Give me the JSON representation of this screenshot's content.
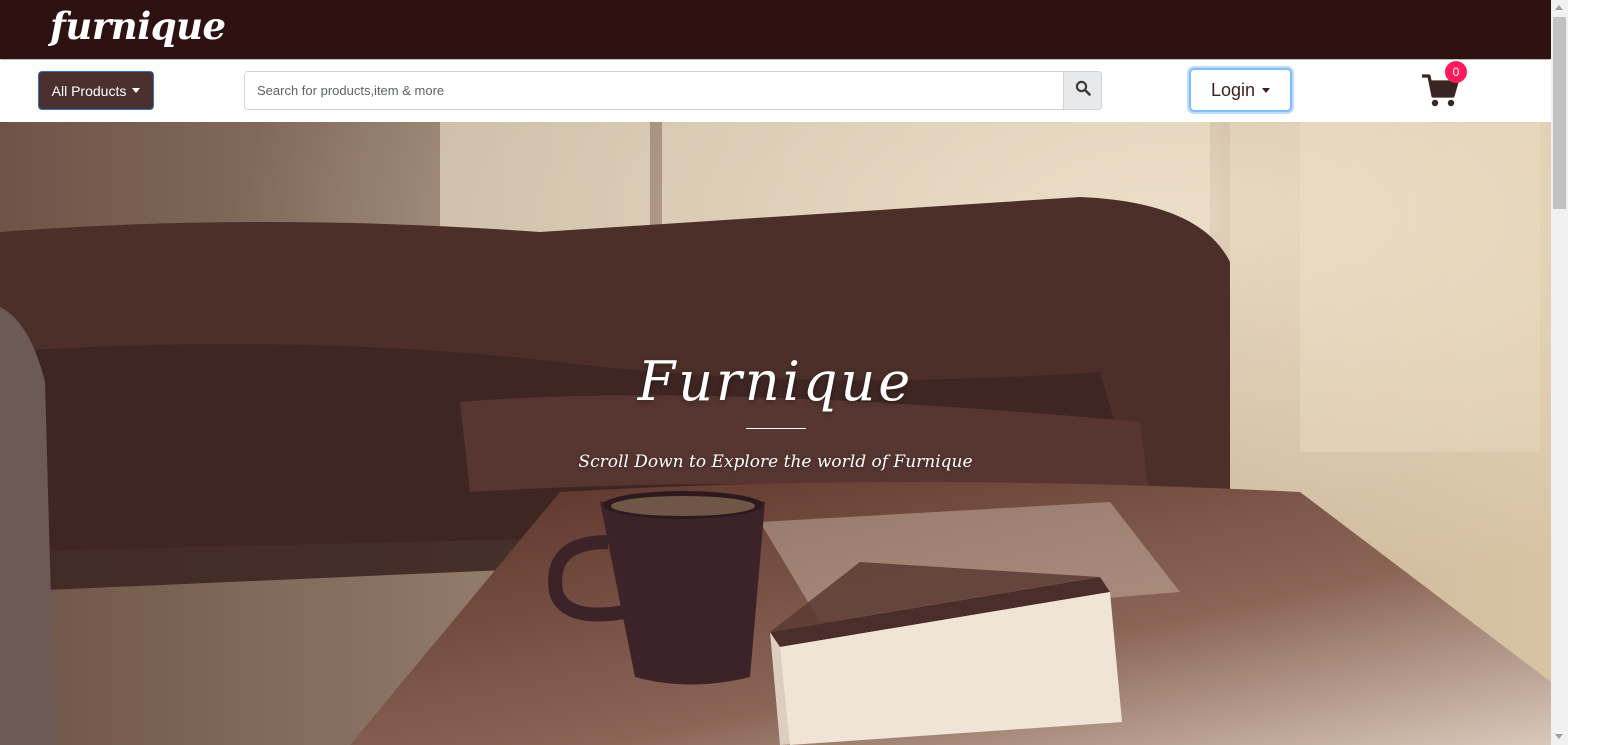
{
  "header": {
    "logo_text": "furnique",
    "background": "#2e1111"
  },
  "nav": {
    "all_products_label": "All Products",
    "search_placeholder": "Search for products,item & more",
    "login_label": "Login",
    "cart_count": "0",
    "search_icon": "search-icon",
    "cart_icon": "shopping-cart-icon"
  },
  "hero": {
    "title": "Furnique",
    "subtitle": "Scroll Down to Explore the world of Furnique"
  },
  "colors": {
    "accent": "#4b3030",
    "badge": "#ff1a5b",
    "focus": "#80bdff"
  }
}
